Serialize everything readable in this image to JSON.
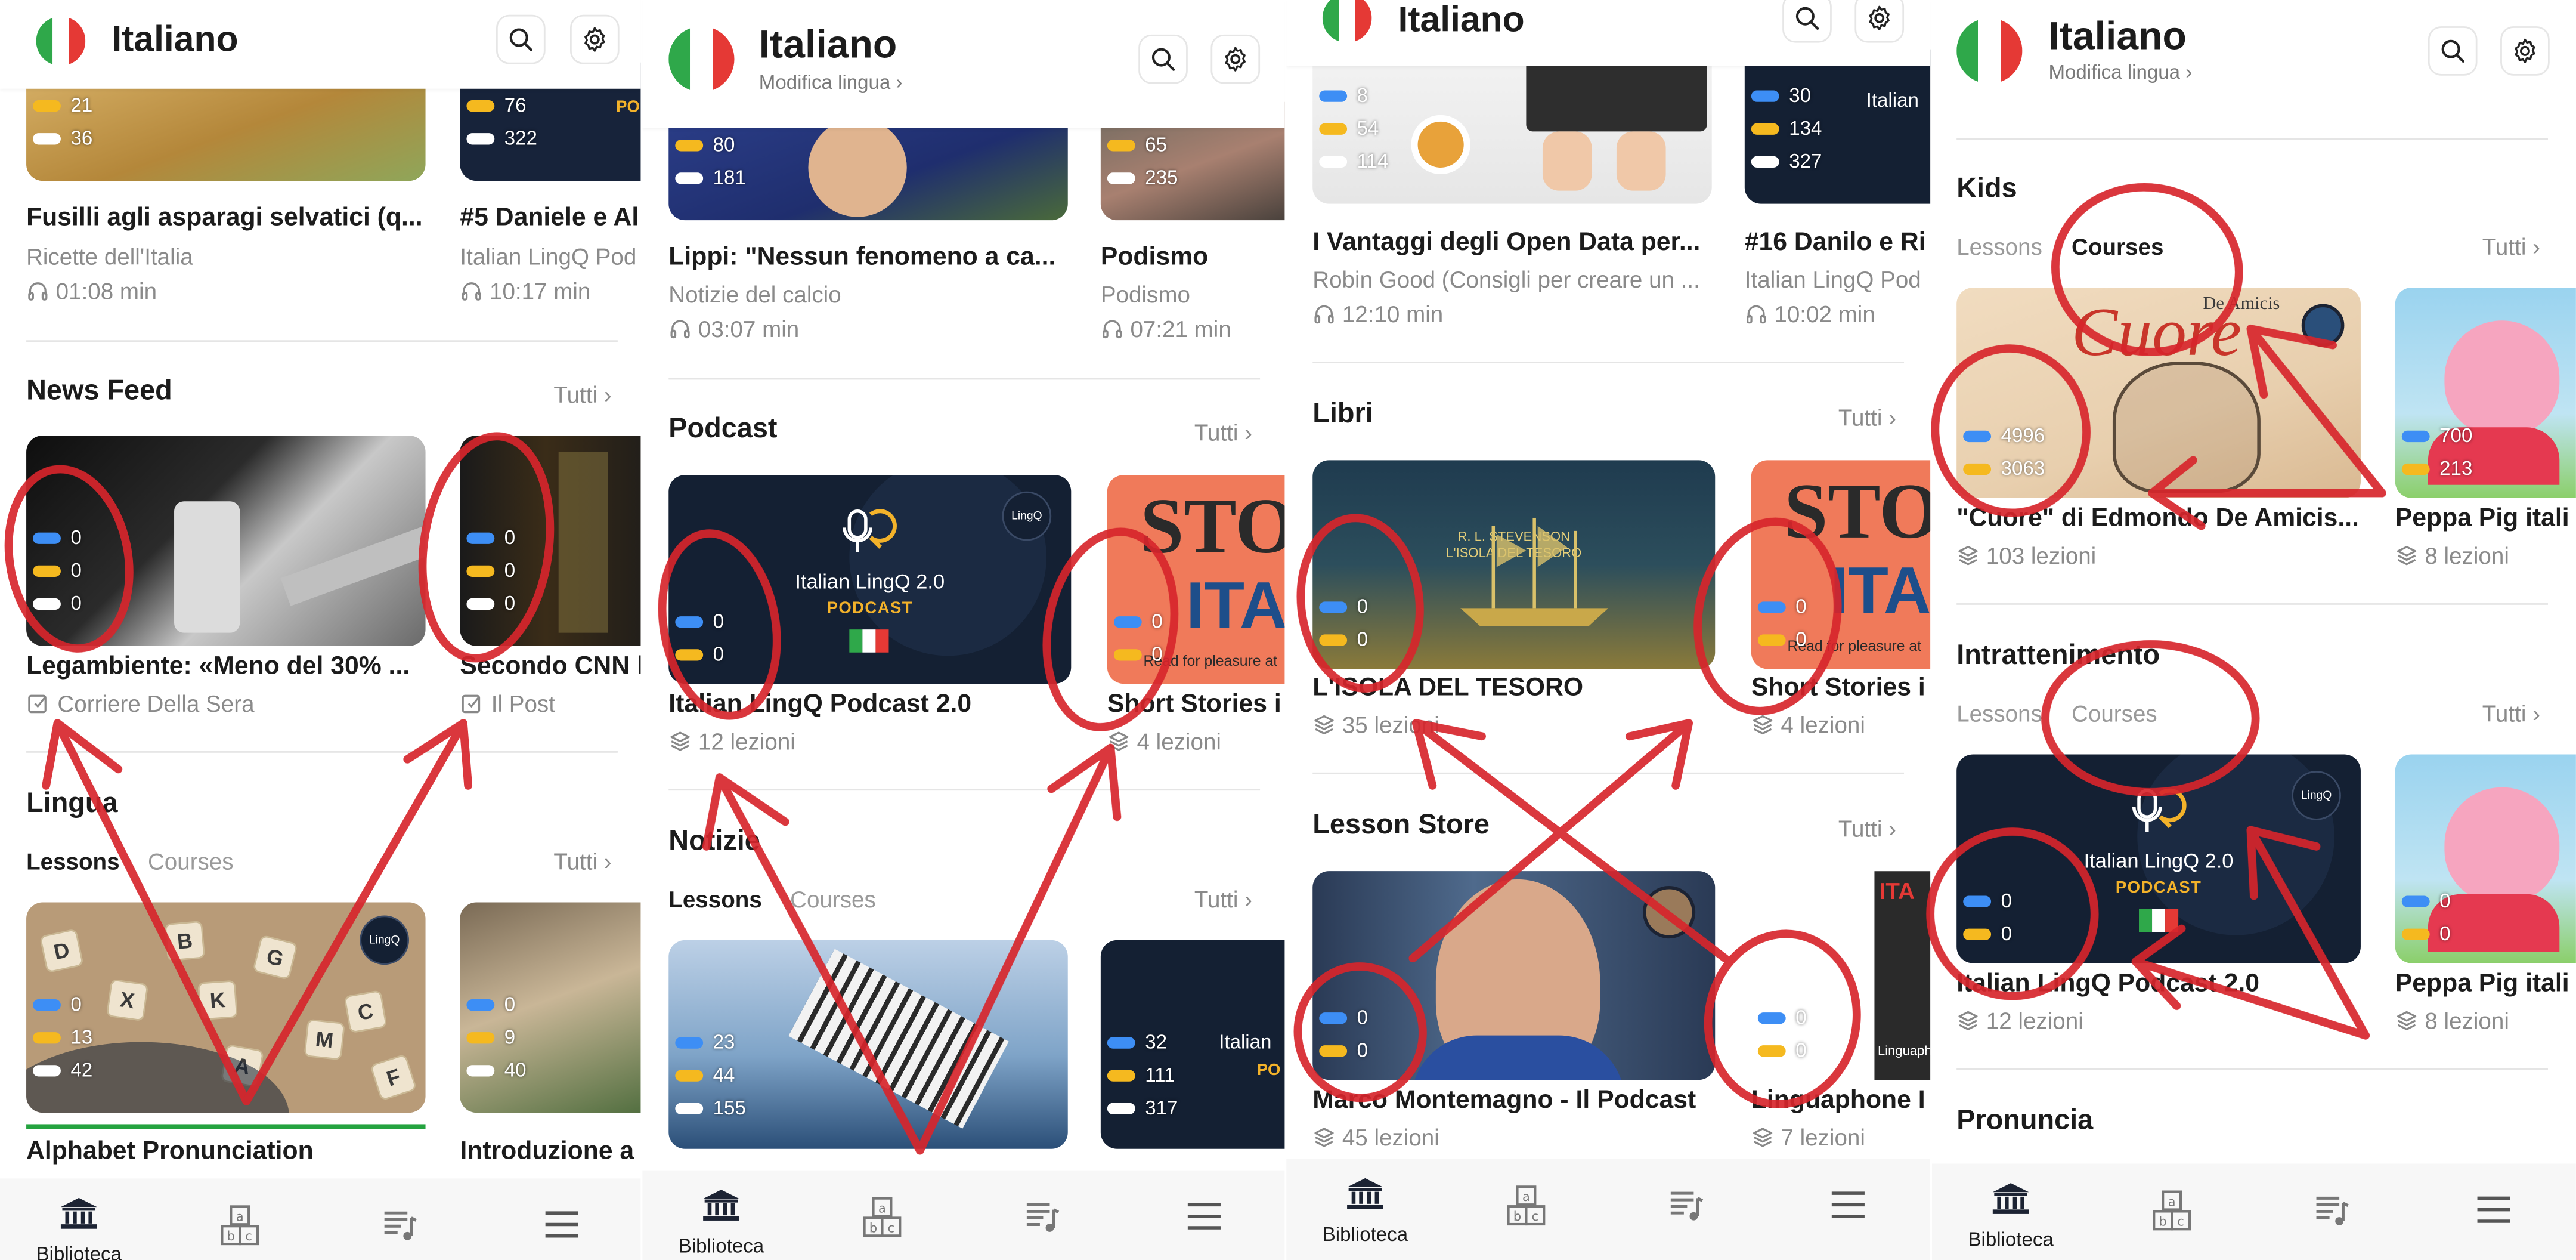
{
  "app": {
    "title": "Italiano",
    "change_language": "Modifica lingua ›",
    "see_all": "Tutti ›",
    "tab_lessons": "Lessons",
    "tab_courses": "Courses",
    "nav": {
      "library_label": "Biblioteca",
      "icons": [
        "library-icon",
        "vocabulary-icon",
        "playlist-icon",
        "menu-icon"
      ]
    },
    "colors": {
      "stat_blue": "#3d8ef5",
      "stat_yellow": "#f5b91f",
      "stat_white": "#ffffff",
      "annotation_red": "#d7262c",
      "progress_green": "#24a33f",
      "flag_green": "#2fa84a",
      "flag_red": "#e53935"
    }
  },
  "panel1": {
    "cards_top": [
      {
        "title": "Fusilli agli asparagi selvatici (q...",
        "source": "Ricette dell'Italia",
        "duration": "01:08 min",
        "stats": [
          "21",
          "36"
        ]
      },
      {
        "title": "#5 Daniele e Al",
        "source": "Italian LingQ Pod",
        "duration": "10:17 min",
        "stats": [
          "76",
          "322"
        ]
      }
    ],
    "news": {
      "title": "News Feed",
      "cards": [
        {
          "title": "Legambiente: «Meno del 30% ...",
          "source": "Corriere Della Sera",
          "stats": [
            "0",
            "0",
            "0"
          ]
        },
        {
          "title": "Secondo CNN l",
          "source": "Il Post",
          "stats": [
            "0",
            "0",
            "0"
          ]
        }
      ]
    },
    "lingua": {
      "title": "Lingua",
      "cards": [
        {
          "title": "Alphabet Pronunciation",
          "stats": [
            "0",
            "13",
            "42"
          ],
          "letters": [
            "D",
            "X",
            "B",
            "G",
            "C",
            "M",
            "F",
            "A",
            "K"
          ]
        },
        {
          "title": "Introduzione a",
          "stats": [
            "0",
            "9",
            "40"
          ]
        }
      ]
    }
  },
  "panel2": {
    "cards_top": [
      {
        "title": "Lippi: \"Nessun fenomeno a ca...",
        "source": "Notizie del calcio",
        "duration": "03:07 min",
        "stats": [
          "80",
          "181"
        ]
      },
      {
        "title": "Podismo",
        "source": "Podismo",
        "duration": "07:21 min",
        "stats": [
          "65",
          "235"
        ]
      }
    ],
    "podcast": {
      "title": "Podcast",
      "cards": [
        {
          "title": "Italian LingQ Podcast 2.0",
          "lessons": "12 lezioni",
          "stats": [
            "0",
            "0"
          ],
          "cover_title": "Italian LingQ 2.0",
          "cover_sub": "PODCAST"
        },
        {
          "title": "Short Stories i",
          "lessons": "4 lezioni",
          "stats": [
            "0",
            "0"
          ],
          "cover_text": "STO",
          "cover_text2": "ITA",
          "cover_tagline": "Read for pleasure at"
        }
      ]
    },
    "notizie": {
      "title": "Notizie",
      "cards": [
        {
          "stats": [
            "23",
            "44",
            "155"
          ]
        },
        {
          "stats": [
            "32",
            "111",
            "317"
          ],
          "cover_title": "Italian",
          "cover_sub": "PO"
        }
      ]
    }
  },
  "panel3": {
    "cards_top": [
      {
        "title": "I Vantaggi degli Open Data per...",
        "source": "Robin Good (Consigli per creare un ...",
        "duration": "12:10 min",
        "stats": [
          "8",
          "54",
          "114"
        ]
      },
      {
        "title": "#16 Danilo e Ri",
        "source": "Italian LingQ Pod",
        "duration": "10:02 min",
        "stats": [
          "30",
          "134",
          "327"
        ],
        "cover_title": "Italian"
      }
    ],
    "libri": {
      "title": "Libri",
      "cards": [
        {
          "title": "L'ISOLA DEL TESORO",
          "lessons": "35 lezioni",
          "stats": [
            "0",
            "0"
          ],
          "cover_author": "R. L. STEVENSON",
          "cover_title": "L'ISOLA DEL TESORO"
        },
        {
          "title": "Short Stories i",
          "lessons": "4 lezioni",
          "stats": [
            "0",
            "0"
          ],
          "cover_text": "STO",
          "cover_text2": "ITA",
          "cover_tagline": "Read for pleasure at"
        }
      ]
    },
    "store": {
      "title": "Lesson Store",
      "cards": [
        {
          "title": "Marco Montemagno - Il Podcast",
          "lessons": "45 lezioni",
          "stats": [
            "0",
            "0"
          ]
        },
        {
          "title": "Linguaphone I",
          "lessons": "7 lezioni",
          "stats": [
            "0",
            "0"
          ],
          "cover_text": "ITA",
          "cover_brand": "Linguaph"
        }
      ]
    }
  },
  "panel4": {
    "kids": {
      "title": "Kids",
      "cards": [
        {
          "title": "\"Cuore\" di Edmondo De Amicis...",
          "lessons": "103 lezioni",
          "stats": [
            "4996",
            "3063"
          ],
          "cover_text": "Cuore",
          "cover_author": "De Amicis"
        },
        {
          "title": "Peppa Pig itali",
          "lessons": "8 lezioni",
          "stats": [
            "700",
            "213"
          ]
        }
      ]
    },
    "intrattenimento": {
      "title": "Intrattenimento",
      "cards": [
        {
          "title": "Italian LingQ Podcast 2.0",
          "lessons": "12 lezioni",
          "stats": [
            "0",
            "0"
          ],
          "cover_title": "Italian LingQ 2.0",
          "cover_sub": "PODCAST"
        },
        {
          "title": "Peppa Pig itali",
          "lessons": "8 lezioni",
          "stats": [
            "0",
            "0"
          ]
        }
      ]
    },
    "pronuncia": {
      "title": "Pronuncia"
    }
  }
}
